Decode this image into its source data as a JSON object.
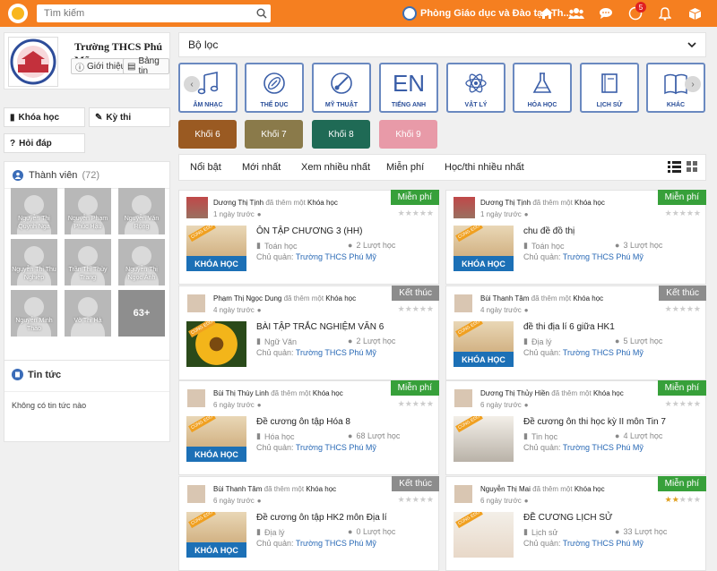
{
  "topbar": {
    "search_placeholder": "Tìm kiếm",
    "org_name": "Phòng Giáo dục và Đào tạo Th...",
    "notification_count": "5",
    "accent": "#f57f20"
  },
  "school": {
    "name": "Trường THCS Phú Mỹ",
    "intro_label": "Giới thiệu",
    "board_label": "Bảng tin",
    "logo_text": "PHÚ MỸ"
  },
  "left_tabs": {
    "courses": "Khóa học",
    "exams": "Kỳ thi",
    "qa": "Hỏi đáp"
  },
  "members": {
    "title": "Thành viên",
    "count": "(72)",
    "list": [
      "Nguyễn Thị Quỳnh Nga",
      "Nguyễn Phạm Phúc Hậu",
      "Nguyễn Văn Rộng",
      "Nguyễn Thị Thu Nghiệp",
      "Trần Thị Thùy Trang",
      "Nguyễn Thị Ngọc Ánh",
      "Nguyễn Minh Thảo",
      "Võ Thị Hà"
    ],
    "more": "63+"
  },
  "news": {
    "title": "Tin tức",
    "empty": "Không có tin tức nào"
  },
  "filter": {
    "label": "Bộ lọc"
  },
  "subjects": [
    {
      "label": "ÂM NHẠC",
      "icon": "music-note-icon"
    },
    {
      "label": "THỂ DỤC",
      "icon": "football-icon"
    },
    {
      "label": "MỸ THUẬT",
      "icon": "paint-brush-icon"
    },
    {
      "label": "TIẾNG ANH",
      "icon": "EN"
    },
    {
      "label": "VẬT LÝ",
      "icon": "atom-icon"
    },
    {
      "label": "HÓA HỌC",
      "icon": "flask-icon"
    },
    {
      "label": "LỊCH SỬ",
      "icon": "book-open-icon"
    },
    {
      "label": "KHÁC",
      "icon": "books-icon"
    }
  ],
  "grades": [
    {
      "label": "Khối 6",
      "color": "#9a5a22"
    },
    {
      "label": "Khối 7",
      "color": "#8a7a4a"
    },
    {
      "label": "Khối 8",
      "color": "#1f6a55"
    },
    {
      "label": "Khối 9",
      "color": "#e89aa8"
    }
  ],
  "sort_tabs": [
    "Nổi bật",
    "Mới nhất",
    "Xem nhiều nhất",
    "Miễn phí",
    "Học/thi nhiều nhất"
  ],
  "cards": [
    {
      "author": "Dương Thị Tịnh",
      "action": "đã thêm một",
      "type": "Khóa học",
      "ago": "1 ngày trước",
      "badge": "Miễn phí",
      "title": "ÔN TẬP CHƯƠNG 3 (HH)",
      "subject": "Toán học",
      "views": "2 Lượt học",
      "owner_label": "Chủ quản:",
      "owner": "Trường THCS Phú Mỹ",
      "stars": 0
    },
    {
      "author": "Dương Thị Tịnh",
      "action": "đã thêm một",
      "type": "Khóa học",
      "ago": "1 ngày trước",
      "badge": "Miễn phí",
      "title": "chu đề đồ thị",
      "subject": "Toán học",
      "views": "3 Lượt học",
      "owner_label": "Chủ quản:",
      "owner": "Trường THCS Phú Mỹ",
      "stars": 0
    },
    {
      "author": "Phạm Thị Ngọc Dung",
      "action": "đã thêm một",
      "type": "Khóa học",
      "ago": "4 ngày trước",
      "badge": "Kết thúc",
      "title": "BÀI TẬP TRẮC NGHIỆM VĂN 6",
      "subject": "Ngữ Văn",
      "views": "2 Lượt học",
      "owner_label": "Chủ quản:",
      "owner": "Trường THCS Phú Mỹ",
      "stars": 0
    },
    {
      "author": "Bùi Thanh Tâm",
      "action": "đã thêm một",
      "type": "Khóa học",
      "ago": "4 ngày trước",
      "badge": "Kết thúc",
      "title": "đề thi địa lí 6 giữa HK1",
      "subject": "Địa lý",
      "views": "5 Lượt học",
      "owner_label": "Chủ quản:",
      "owner": "Trường THCS Phú Mỹ",
      "stars": 0
    },
    {
      "author": "Bùi Thị Thùy Linh",
      "action": "đã thêm một",
      "type": "Khóa học",
      "ago": "6 ngày trước",
      "badge": "Miễn phí",
      "title": "Đề cương ôn tập Hóa 8",
      "subject": "Hóa học",
      "views": "68 Lượt học",
      "owner_label": "Chủ quản:",
      "owner": "Trường THCS Phú Mỹ",
      "stars": 0
    },
    {
      "author": "Dương Thị Thủy Hiền",
      "action": "đã thêm một",
      "type": "Khóa học",
      "ago": "6 ngày trước",
      "badge": "Miễn phí",
      "title": "Đề cương ôn thi học kỳ II môn Tin 7",
      "subject": "Tin học",
      "views": "4 Lượt học",
      "owner_label": "Chủ quản:",
      "owner": "Trường THCS Phú Mỹ",
      "stars": 0
    },
    {
      "author": "Bùi Thanh Tâm",
      "action": "đã thêm một",
      "type": "Khóa học",
      "ago": "6 ngày trước",
      "badge": "Kết thúc",
      "title": "Đề cương ôn tập HK2 môn Địa lí",
      "subject": "Địa lý",
      "views": "0 Lượt học",
      "owner_label": "Chủ quản:",
      "owner": "Trường THCS Phú Mỹ",
      "stars": 0
    },
    {
      "author": "Nguyễn Thị Mai",
      "action": "đã thêm một",
      "type": "Khóa học",
      "ago": "6 ngày trước",
      "badge": "Miễn phí",
      "title": "ĐỀ CƯƠNG LỊCH SỬ",
      "subject": "Lịch sử",
      "views": "33 Lượt học",
      "owner_label": "Chủ quản:",
      "owner": "Trường THCS Phú Mỹ",
      "stars": 2
    }
  ],
  "thumb_label": "KHÓA HỌC",
  "thumb_tag": "CÙNG EDU"
}
